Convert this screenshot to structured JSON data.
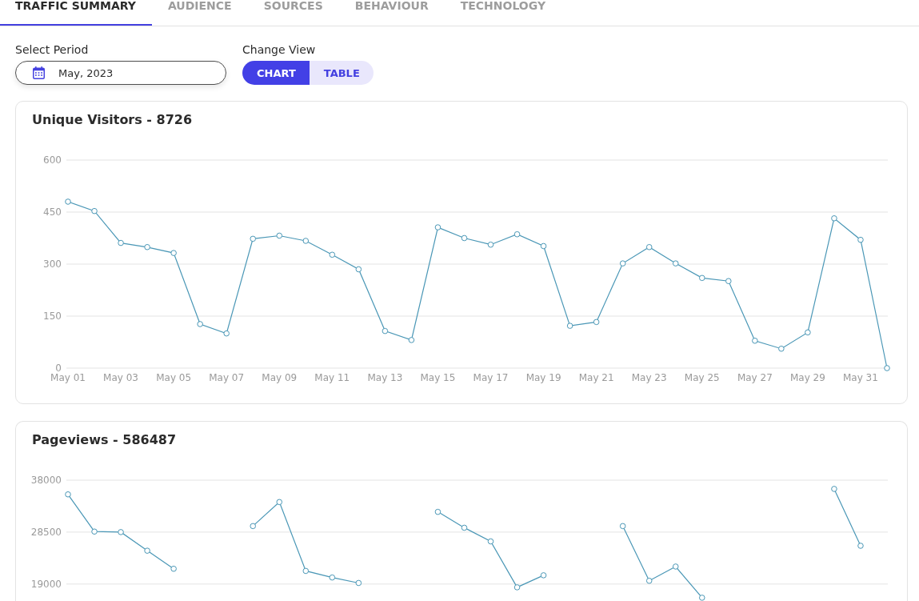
{
  "tabs": [
    {
      "label": "TRAFFIC SUMMARY",
      "selected": true
    },
    {
      "label": "AUDIENCE",
      "selected": false
    },
    {
      "label": "SOURCES",
      "selected": false
    },
    {
      "label": "BEHAVIOUR",
      "selected": false
    },
    {
      "label": "TECHNOLOGY",
      "selected": false
    }
  ],
  "filters": {
    "period": {
      "label": "Select Period",
      "value": "May, 2023"
    },
    "view": {
      "label": "Change View",
      "options": [
        {
          "label": "CHART",
          "selected": true
        },
        {
          "label": "TABLE",
          "selected": false
        }
      ]
    }
  },
  "charts": [
    {
      "chart_data": {
        "type": "line",
        "title": "Unique Visitors - 8726",
        "grid": true,
        "marker": true,
        "categories": [
          "May 01",
          null,
          "May 03",
          null,
          "May 05",
          null,
          "May 07",
          null,
          "May 09",
          null,
          "May 11",
          null,
          "May 13",
          null,
          "May 15",
          null,
          "May 17",
          null,
          "May 19",
          null,
          "May 21",
          null,
          "May 23",
          null,
          "May 25",
          null,
          "May 27",
          null,
          "May 29",
          null,
          "May 31",
          null
        ],
        "ylim": [
          0,
          600
        ],
        "yticks": [
          0,
          150,
          300,
          450,
          600
        ],
        "values": [
          480,
          453,
          361,
          349,
          332,
          127,
          100,
          373,
          382,
          367,
          327,
          285,
          107,
          81,
          406,
          375,
          356,
          386,
          352,
          122,
          133,
          302,
          349,
          302,
          260,
          251,
          79,
          56,
          103,
          432,
          370,
          0
        ]
      }
    },
    {
      "chart_data": {
        "type": "line",
        "title": "Pageviews - 586487",
        "grid": true,
        "marker": true,
        "ylim": [
          15900,
          38000
        ],
        "yticks": [
          19000,
          28500,
          38000
        ],
        "values": [
          35400,
          28600,
          28500,
          25100,
          21800,
          null,
          null,
          29600,
          34000,
          21400,
          20200,
          19200,
          null,
          null,
          32200,
          29300,
          26800,
          18400,
          20600,
          null,
          null,
          29600,
          19600,
          22200,
          16500,
          null,
          null,
          null,
          null,
          36400,
          26000,
          null
        ]
      }
    }
  ]
}
